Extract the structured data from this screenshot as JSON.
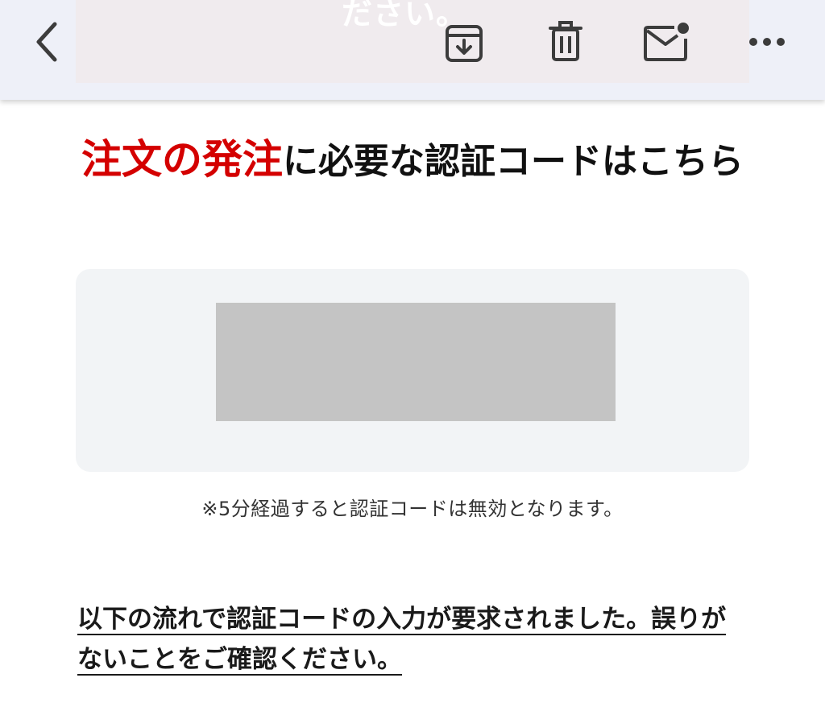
{
  "toolbar": {
    "banner_text": "ださい。",
    "icons": {
      "back": "chevron-left-icon",
      "archive": "archive-icon",
      "delete": "trash-icon",
      "mark_unread": "mail-unread-icon",
      "more": "more-horizontal-icon"
    }
  },
  "content": {
    "headline_accent": "注文の発注",
    "headline_rest": "に必要な認証コードはこちら",
    "code_value_hidden": true,
    "expiry_note": "※5分経過すると認証コードは無効となります。",
    "flow_text": "以下の流れで認証コードの入力が要求されました。誤りがないことをご確認ください。"
  },
  "colors": {
    "accent": "#d40000",
    "toolbar_bg": "#eef0f8",
    "code_box_bg": "#f2f4f6",
    "redaction": "#c4c4c4"
  }
}
